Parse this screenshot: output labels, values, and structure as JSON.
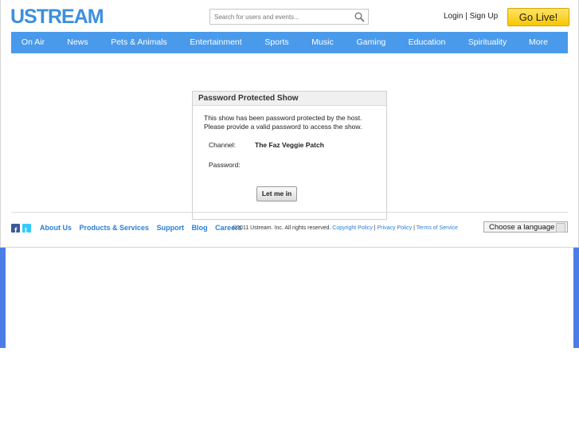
{
  "header": {
    "logo_text": "USTREAM",
    "search_placeholder": "Search for users and events...",
    "login": "Login",
    "separator": "|",
    "signup": "Sign Up",
    "go_live": "Go Live!"
  },
  "nav": {
    "items": [
      "On Air",
      "News",
      "Pets & Animals",
      "Entertainment",
      "Sports",
      "Music",
      "Gaming",
      "Education",
      "Spirituality",
      "More"
    ]
  },
  "dialog": {
    "title": "Password Protected Show",
    "message_line1": "This show has been password protected by the host.",
    "message_line2": "Please provide a valid password to access the show.",
    "channel_label": "Channel:",
    "channel_value": "The Faz Veggie Patch",
    "password_label": "Password:",
    "submit": "Let me in"
  },
  "footer": {
    "links": [
      "About Us",
      "Products & Services",
      "Support",
      "Blog",
      "Careers"
    ],
    "copyright": "©2011 Ustream. Inc. All rights reserved.",
    "copyright_policy": "Copyright Policy",
    "privacy_policy": "Privacy Policy",
    "terms": "Terms of Service",
    "sep": "|",
    "language": "Choose a language"
  },
  "colors": {
    "brand_blue": "#4a9aeb",
    "go_live_yellow": "#f7c600"
  }
}
